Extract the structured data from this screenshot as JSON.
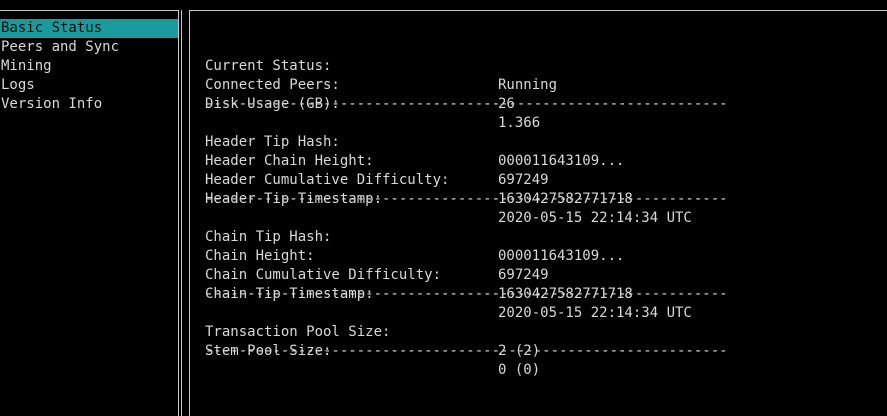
{
  "sidebar": {
    "items": [
      {
        "label": "Basic Status"
      },
      {
        "label": "Peers and Sync"
      },
      {
        "label": "Mining"
      },
      {
        "label": "Logs"
      },
      {
        "label": "Version Info"
      }
    ]
  },
  "separator": "--------------------------------------------------------------",
  "status": {
    "current_status": {
      "label": "Current Status:",
      "value": "Running"
    },
    "connected_peers": {
      "label": "Connected Peers:",
      "value": "26"
    },
    "disk_usage": {
      "label": "Disk Usage (GB):",
      "value": "1.366"
    }
  },
  "header": {
    "tip_hash": {
      "label": "Header Tip Hash:",
      "value": "000011643109..."
    },
    "chain_height": {
      "label": "Header Chain Height:",
      "value": "697249"
    },
    "cumulative_difficulty": {
      "label": "Header Cumulative Difficulty:",
      "value": "1630427582771718"
    },
    "tip_timestamp": {
      "label": "Header Tip Timestamp:",
      "value": "2020-05-15 22:14:34 UTC"
    }
  },
  "chain": {
    "tip_hash": {
      "label": "Chain Tip Hash:",
      "value": "000011643109..."
    },
    "height": {
      "label": "Chain Height:",
      "value": "697249"
    },
    "cumulative_difficulty": {
      "label": "Chain Cumulative Difficulty:",
      "value": "1630427582771718"
    },
    "tip_timestamp": {
      "label": "Chain Tip Timestamp:",
      "value": "2020-05-15 22:14:34 UTC"
    }
  },
  "pool": {
    "transaction_pool_size": {
      "label": "Transaction Pool Size:",
      "value": "2 (2)"
    },
    "stem_pool_size": {
      "label": "Stem Pool Size:",
      "value": "0 (0)"
    }
  },
  "colors": {
    "selected_background": "#1a9a9c",
    "text": "#d8d8d8",
    "background": "#000000"
  }
}
